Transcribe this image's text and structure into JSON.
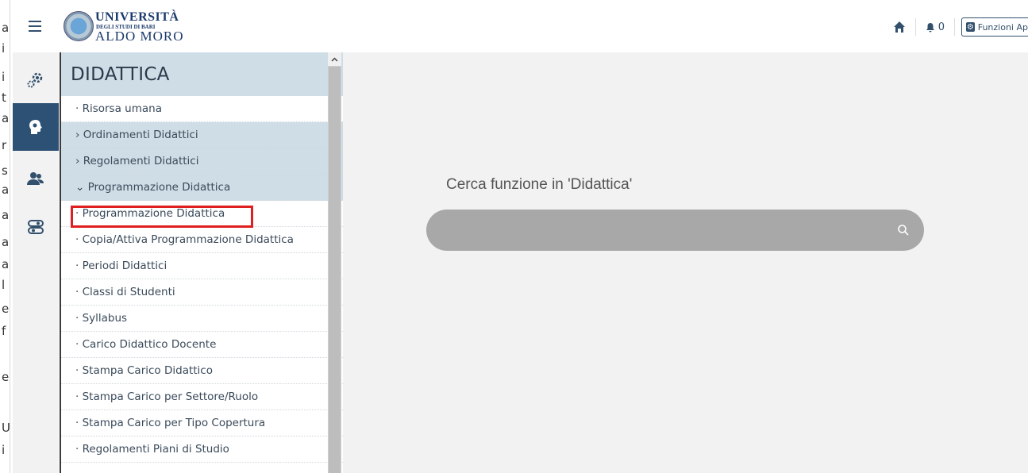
{
  "header": {
    "logo": {
      "line1": "UNIVERSITÀ",
      "line2": "DEGLI STUDI DI BARI",
      "line3": "ALDO MORO"
    },
    "notification_count": "0",
    "functions_button_label": "Funzioni Ap"
  },
  "left_strip_letters": [
    "a",
    "i",
    "i",
    "t",
    "a",
    "r",
    "s",
    "a",
    "a",
    "a",
    "a",
    "l",
    "e",
    "f",
    "e",
    "U",
    "i"
  ],
  "sidebar": {
    "items": [
      {
        "icon": "gears-icon",
        "active": false
      },
      {
        "icon": "brain-head-icon",
        "active": true
      },
      {
        "icon": "users-icon",
        "active": false
      },
      {
        "icon": "toggles-icon",
        "active": false
      }
    ]
  },
  "panel": {
    "title": "DIDATTICA",
    "items": [
      {
        "label": "· Risorsa umana",
        "group": false
      },
      {
        "label": "› Ordinamenti Didattici",
        "group": true
      },
      {
        "label": "› Regolamenti Didattici",
        "group": true
      },
      {
        "label": "⌄ Programmazione Didattica",
        "group": true
      },
      {
        "label": "· Programmazione Didattica",
        "group": false,
        "highlighted": true
      },
      {
        "label": "· Copia/Attiva Programmazione Didattica",
        "group": false
      },
      {
        "label": "· Periodi Didattici",
        "group": false
      },
      {
        "label": "· Classi di Studenti",
        "group": false
      },
      {
        "label": "· Syllabus",
        "group": false
      },
      {
        "label": "· Carico Didattico Docente",
        "group": false
      },
      {
        "label": "· Stampa Carico Didattico",
        "group": false
      },
      {
        "label": "· Stampa Carico per Settore/Ruolo",
        "group": false
      },
      {
        "label": "· Stampa Carico per Tipo Copertura",
        "group": false
      },
      {
        "label": "· Regolamenti Piani di Studio",
        "group": false
      }
    ]
  },
  "main": {
    "search_label": "Cerca funzione in 'Didattica'",
    "search_placeholder": ""
  },
  "colors": {
    "primary": "#2c5174",
    "panel_header": "#cfdde6",
    "highlight": "#e02020",
    "search_bg": "#a8a8a8"
  }
}
